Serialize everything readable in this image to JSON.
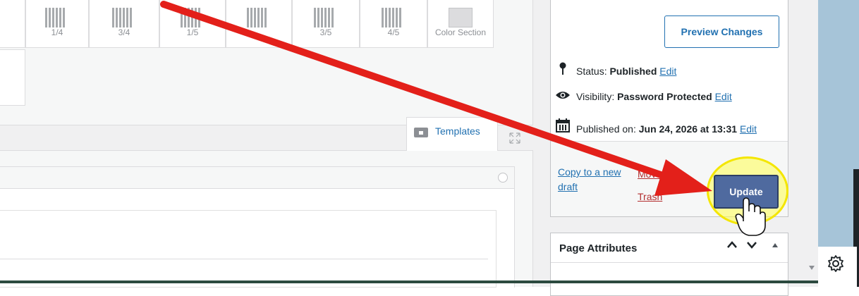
{
  "layouts": {
    "labels": [
      "1/4",
      "3/4",
      "1/5",
      "3/5",
      "4/5",
      "Color Section"
    ]
  },
  "tabs": {
    "templates_label": "Templates"
  },
  "publish": {
    "preview_label": "Preview Changes",
    "status_prefix": "Status: ",
    "status_value": "Published",
    "visibility_prefix": "Visibility: ",
    "visibility_value": "Password Protected",
    "published_prefix": "Published on: ",
    "published_value": "Jun 24, 2026 at 13:31",
    "edit_label": "Edit",
    "copy_draft_label": "Copy to a new draft",
    "trash_label": "Move to Trash",
    "update_label": "Update"
  },
  "page_attributes": {
    "title": "Page Attributes"
  },
  "icons": {
    "status": "pin-icon",
    "visibility": "eye-icon",
    "published": "calendar-icon",
    "settings": "gear-icon",
    "templates": "folder-icon",
    "expand": "expand-icon"
  },
  "colors": {
    "link": "#2271b1",
    "update_button": "#4f6a9f",
    "trash": "#b32d2e",
    "annotation_arrow": "#e3201a",
    "highlight": "#f4e600"
  }
}
